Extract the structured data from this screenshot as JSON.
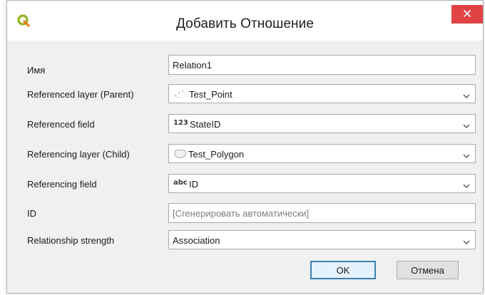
{
  "window": {
    "title": "Добавить Отношение",
    "close_icon": "close-icon",
    "app_icon": "qgis-logo-icon"
  },
  "form": {
    "name": {
      "label": "Имя",
      "value": "Relation1"
    },
    "referenced_layer": {
      "label": "Referenced layer (Parent)",
      "value": "Test_Point",
      "icon": "point-layer-icon"
    },
    "referenced_field": {
      "label": "Referenced field",
      "type_badge": "123",
      "value": "StateID"
    },
    "referencing_layer": {
      "label": "Referencing layer (Child)",
      "value": "Test_Polygon",
      "icon": "polygon-layer-icon"
    },
    "referencing_field": {
      "label": "Referencing field",
      "type_badge": "abc",
      "value": "ID"
    },
    "id": {
      "label": "ID",
      "placeholder": "[Сгенерировать автоматически]"
    },
    "strength": {
      "label": "Relationship strength",
      "value": "Association"
    }
  },
  "buttons": {
    "ok": "OK",
    "cancel": "Отмена"
  },
  "colors": {
    "close_button": "#e04343",
    "default_button_border": "#3c7fb1"
  }
}
